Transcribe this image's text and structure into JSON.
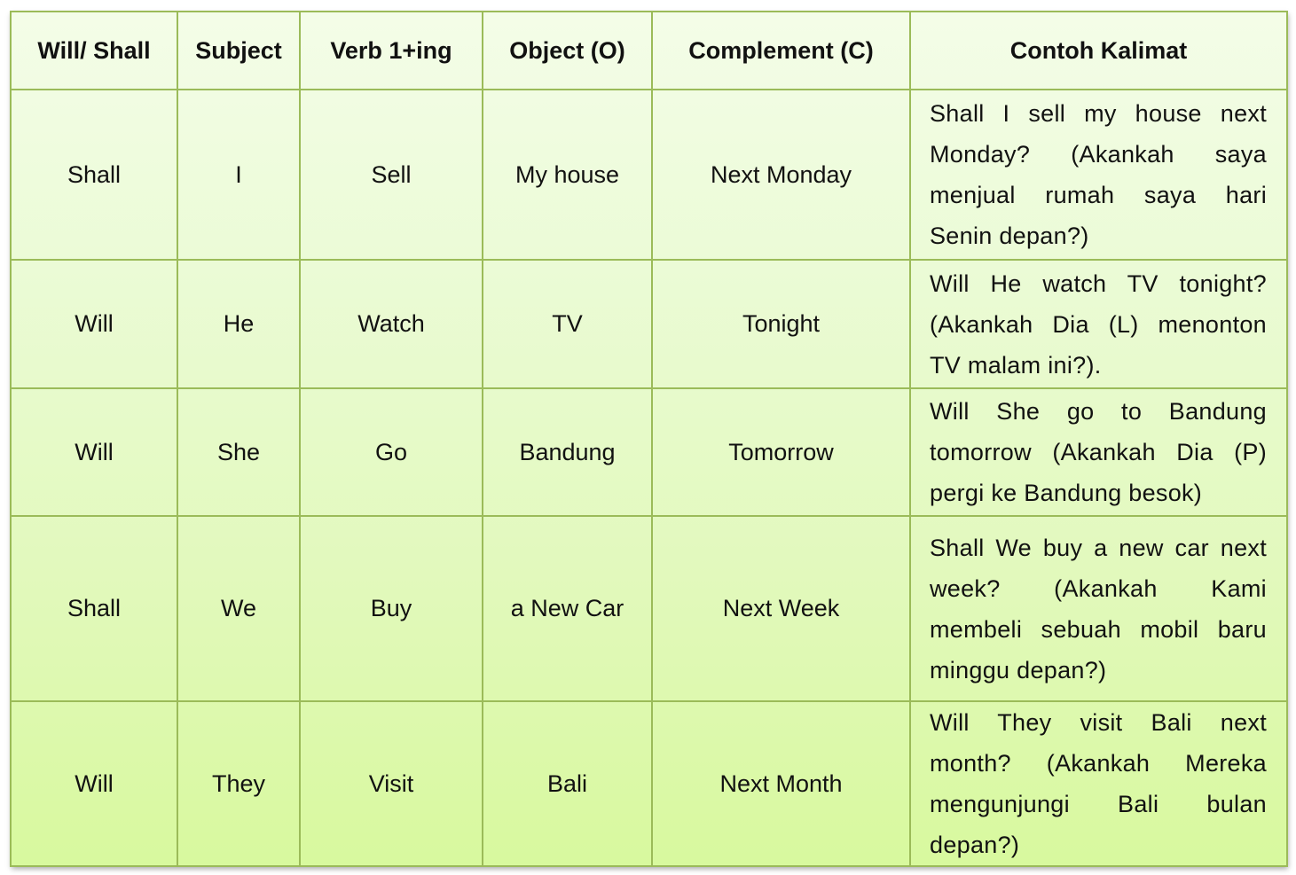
{
  "table": {
    "headers": [
      "Will/ Shall",
      "Subject",
      "Verb 1+ing",
      "Object (O)",
      "Complement (C)",
      "Contoh Kalimat"
    ],
    "rows": [
      [
        "Shall",
        "I",
        "Sell",
        "My house",
        "Next Monday",
        "Shall I sell my house next Monday? (Akankah saya menjual rumah saya hari Senin depan?)"
      ],
      [
        "Will",
        "He",
        "Watch",
        "TV",
        "Tonight",
        "Will He watch TV tonight? (Akankah Dia (L) menonton TV malam ini?)."
      ],
      [
        "Will",
        "She",
        "Go",
        "Bandung",
        "Tomorrow",
        "Will She go to Bandung tomorrow (Akankah Dia (P) pergi ke Bandung besok)"
      ],
      [
        "Shall",
        "We",
        "Buy",
        "a New Car",
        "Next Week",
        "Shall We buy a new car next week? (Akankah Kami membeli sebuah mobil baru minggu depan?)"
      ],
      [
        "Will",
        "They",
        "Visit",
        "Bali",
        "Next Month",
        "Will They visit Bali next month? (Akankah Mereka mengunjungi Bali bulan depan?)"
      ]
    ]
  },
  "colors": {
    "border": "#9bbb59",
    "fill_top": "#f4fde8",
    "fill_bottom": "#d8f99e"
  }
}
